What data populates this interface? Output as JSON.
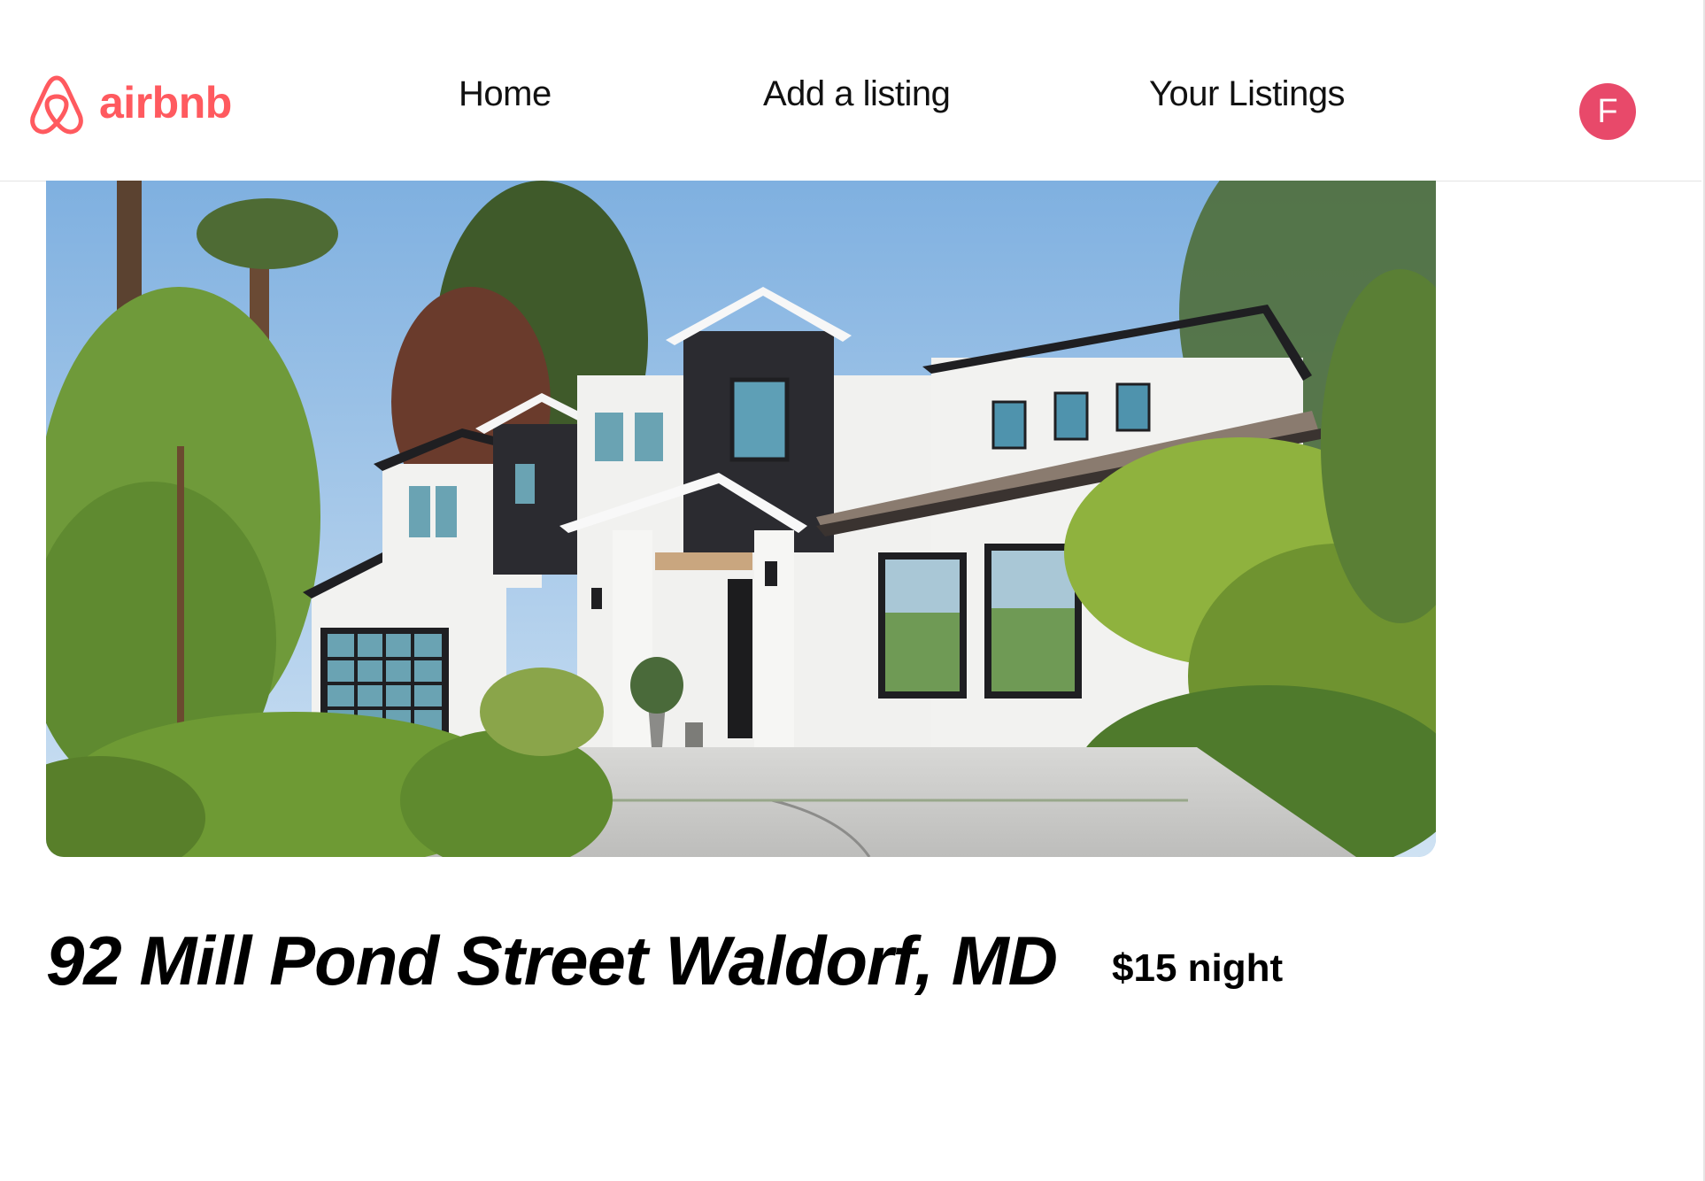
{
  "brand": {
    "name": "airbnb",
    "color": "#ff5a5f",
    "icon": "airbnb-belo-icon"
  },
  "nav": {
    "items": [
      {
        "label": "Home"
      },
      {
        "label": "Add a listing"
      },
      {
        "label": "Your Listings"
      }
    ]
  },
  "user": {
    "initial": "F",
    "avatar_color": "#e8496a"
  },
  "listing": {
    "photo_icon": "house-photo",
    "title": "92 Mill Pond Street Waldorf, MD",
    "price": "$15 night"
  }
}
